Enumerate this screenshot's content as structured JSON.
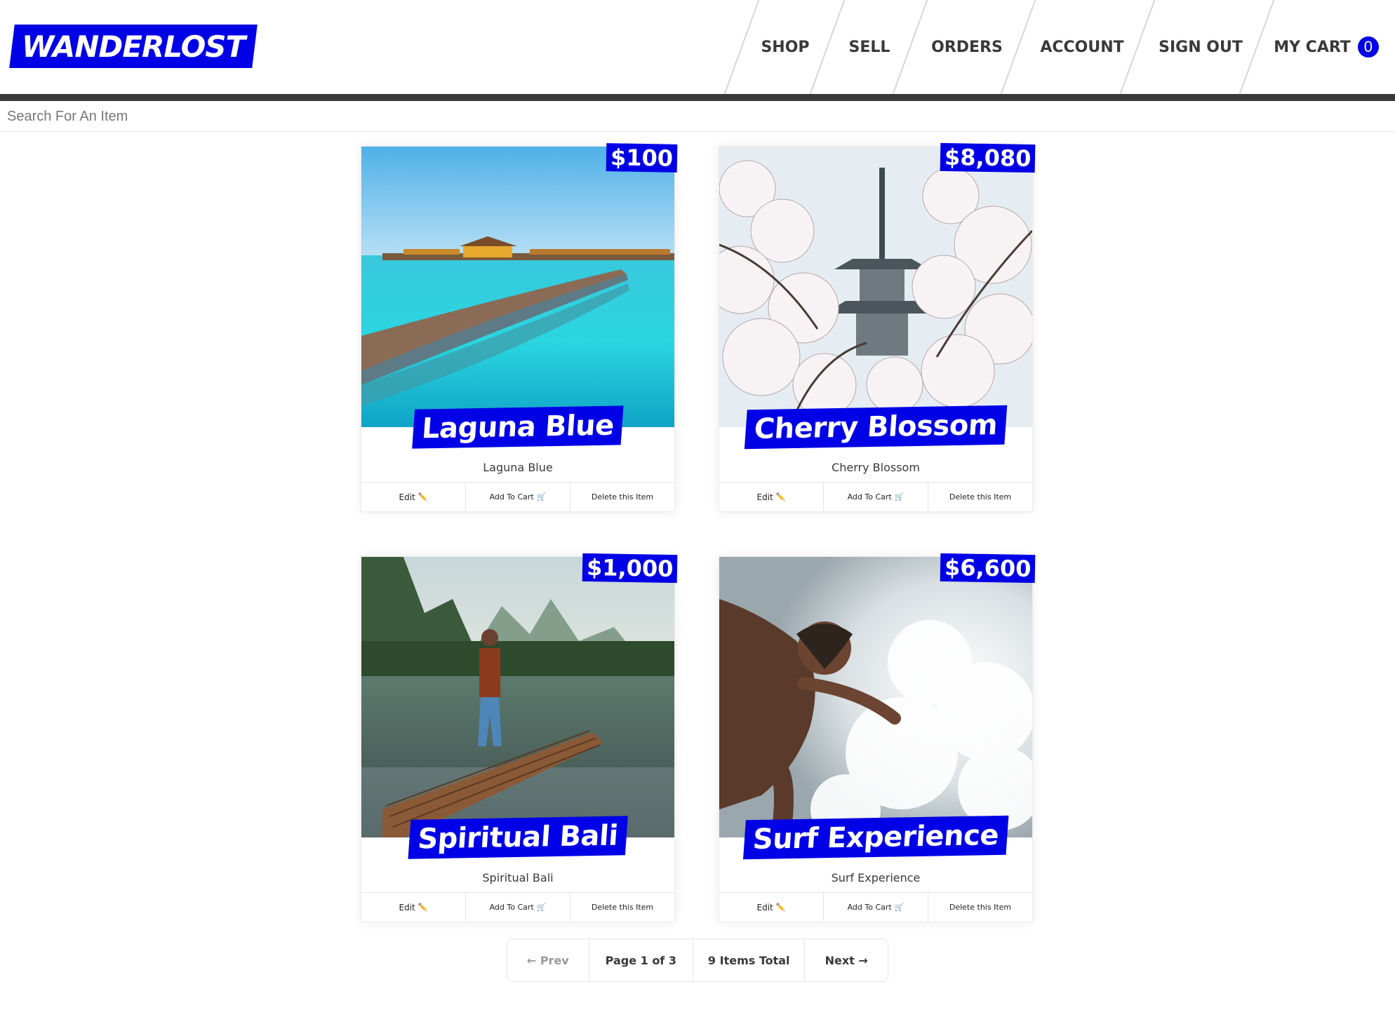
{
  "brand": {
    "name": "WANDERLOST",
    "accent": "#0000e6"
  },
  "nav": {
    "items": [
      {
        "label": "Shop"
      },
      {
        "label": "Sell"
      },
      {
        "label": "Orders"
      },
      {
        "label": "Account"
      },
      {
        "label": "Sign Out"
      }
    ],
    "cart_label": "My Cart",
    "cart_count": "0"
  },
  "search": {
    "placeholder": "Search For An Item",
    "value": ""
  },
  "products": [
    {
      "title": "Laguna Blue",
      "name": "Laguna Blue",
      "price": "$100",
      "image": "maldives-overwater-villas-photo"
    },
    {
      "title": "Cherry Blossom",
      "name": "Cherry Blossom",
      "price": "$8,080",
      "image": "cherry-blossom-pagoda-photo"
    },
    {
      "title": "Spiritual Bali",
      "name": "Spiritual Bali",
      "price": "$1,000",
      "image": "bamboo-raft-river-photo"
    },
    {
      "title": "Surf Experience",
      "name": "Surf Experience",
      "price": "$6,600",
      "image": "surfer-splash-photo"
    }
  ],
  "card_actions": {
    "edit": "Edit",
    "edit_icon": "pencil-icon",
    "add_to_cart": "Add To Cart",
    "cart_icon": "shopping-cart-icon",
    "delete": "Delete this Item"
  },
  "pagination": {
    "prev": "← Prev",
    "page": "Page 1 of 3",
    "total": "9 Items Total",
    "next": "Next →"
  }
}
